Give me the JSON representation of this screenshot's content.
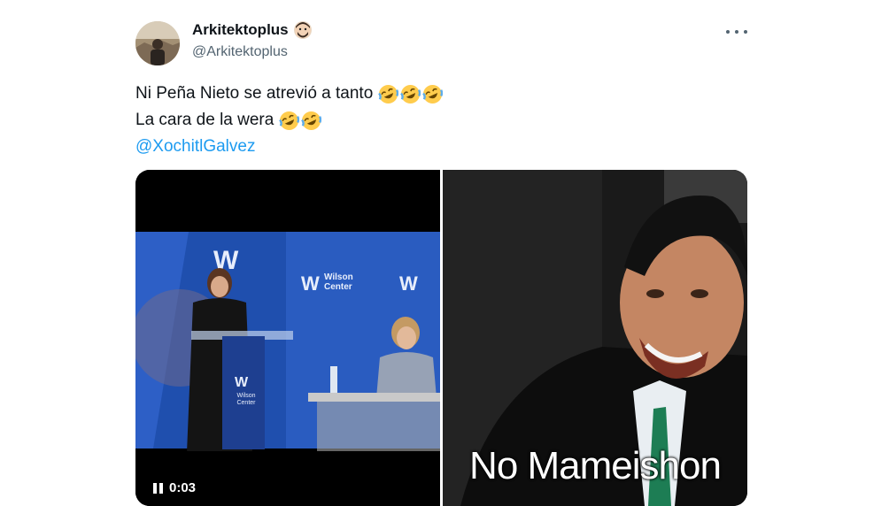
{
  "tweet": {
    "author_name": "Arkitektoplus",
    "author_handle": "@Arkitektoplus",
    "author_badge_icon": "man-face-emoji-icon",
    "more_icon": "more-options-icon",
    "text_line1": "Ni Peña Nieto se atrevió a tanto",
    "text_line2": "La cara de la wera",
    "mention": "@XochitlGalvez",
    "line1_emojis": [
      "rofl-emoji-icon",
      "rofl-emoji-icon",
      "rofl-emoji-icon"
    ],
    "line2_emojis": [
      "rofl-emoji-icon",
      "rofl-emoji-icon"
    ]
  },
  "media": {
    "video": {
      "duration": "0:03",
      "podium_sign": "Wilson Center",
      "backdrop_sign": "Wilson Center"
    },
    "meme": {
      "caption": "No Mameishon"
    }
  },
  "colors": {
    "text": "#0f1419",
    "secondary": "#536471",
    "link": "#1d9bf0",
    "wilson_blue": "#1f4fae"
  }
}
